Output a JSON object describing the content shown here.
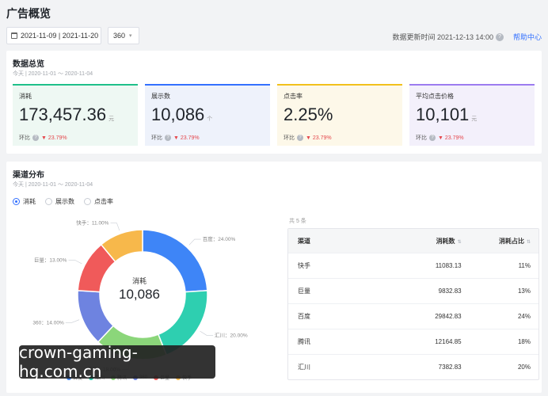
{
  "page_title": "广告概览",
  "toolbar": {
    "date_range": "2021-11-09 | 2021-11-20",
    "channel_select": "360",
    "update_time": "数据更新时间 2021-12-13 14:00",
    "help_link": "帮助中心"
  },
  "summary": {
    "title": "数据总览",
    "subtitle": "今天 | 2020-11-01 ～ 2020-11-04",
    "metrics": [
      {
        "label": "消耗",
        "value": "173,457.36",
        "unit": "元",
        "compare_label": "环比",
        "change": "▼ 23.79%",
        "accent": "#1fc08a",
        "bg": "#eef8f3"
      },
      {
        "label": "展示数",
        "value": "10,086",
        "unit": "个",
        "compare_label": "环比",
        "change": "▼ 23.79%",
        "accent": "#3370ff",
        "bg": "#eef2fb"
      },
      {
        "label": "点击率",
        "value": "2.25%",
        "unit": "",
        "compare_label": "环比",
        "change": "▼ 23.79%",
        "accent": "#f2c11c",
        "bg": "#fdf8e9"
      },
      {
        "label": "平均点击价格",
        "value": "10,101",
        "unit": "元",
        "compare_label": "环比",
        "change": "▼ 23.79%",
        "accent": "#9c7cf0",
        "bg": "#f3f0fb"
      }
    ]
  },
  "channel": {
    "title": "渠道分布",
    "subtitle": "今天 | 2020-11-01 ～ 2020-11-04",
    "radios": [
      "消耗",
      "展示数",
      "点击率"
    ],
    "selected_radio": 0,
    "donut_center_label": "消耗",
    "donut_center_value": "10,086",
    "slices": [
      {
        "name": "百度",
        "label": "百度：24.00%",
        "value": 24,
        "color": "#3e85f7"
      },
      {
        "name": "汇川",
        "label": "汇川：20.00%",
        "value": 20,
        "color": "#2ecfb0"
      },
      {
        "name": "腾讯",
        "label": "腾讯：18.00%",
        "value": 18,
        "color": "#8bd67a"
      },
      {
        "name": "360",
        "label": "360：14.00%",
        "value": 14,
        "color": "#6e83e0"
      },
      {
        "name": "巨量",
        "label": "巨量：13.00%",
        "value": 13,
        "color": "#f05a5a"
      },
      {
        "name": "快手",
        "label": "快手：11.00%",
        "value": 11,
        "color": "#f7b84b"
      }
    ],
    "table": {
      "total_text": "共 5 条",
      "headers": [
        "渠道",
        "消耗数",
        "消耗占比"
      ],
      "rows": [
        [
          "快手",
          "11083.13",
          "11%"
        ],
        [
          "巨量",
          "9832.83",
          "13%"
        ],
        [
          "百度",
          "29842.83",
          "24%"
        ],
        [
          "腾讯",
          "12164.85",
          "18%"
        ],
        [
          "汇川",
          "7382.83",
          "20%"
        ]
      ]
    }
  },
  "watermark": "crown-gaming-hg.com.cn"
}
